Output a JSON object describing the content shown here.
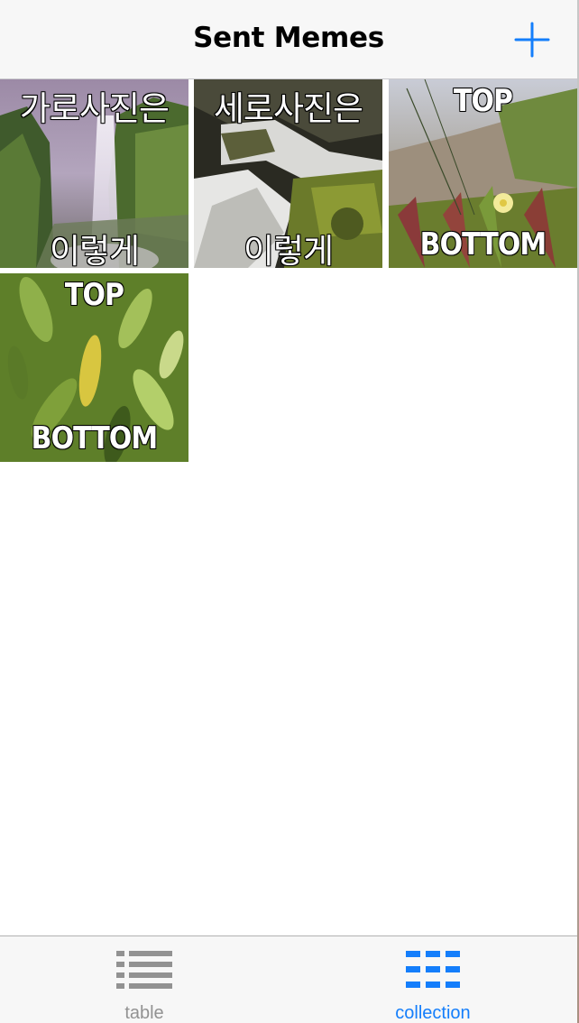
{
  "nav": {
    "title": "Sent Memes",
    "add_icon": "plus-icon"
  },
  "memes": [
    {
      "top": "가로사진은",
      "bottom": "이렇게",
      "image": "waterfall-cliff-photo"
    },
    {
      "top": "세로사진은",
      "bottom": "이렇게",
      "image": "waterfall-stream-photo"
    },
    {
      "top": "TOP",
      "bottom": "BOTTOM",
      "image": "dune-grass-flower-photo"
    },
    {
      "top": "TOP",
      "bottom": "BOTTOM",
      "image": "green-leaves-photo"
    }
  ],
  "tabs": [
    {
      "label": "table",
      "icon": "list-icon",
      "selected": false
    },
    {
      "label": "collection",
      "icon": "grid-icon",
      "selected": true
    }
  ],
  "colors": {
    "accent": "#147efb",
    "inactive": "#929292",
    "bar_background": "#f7f7f7"
  }
}
